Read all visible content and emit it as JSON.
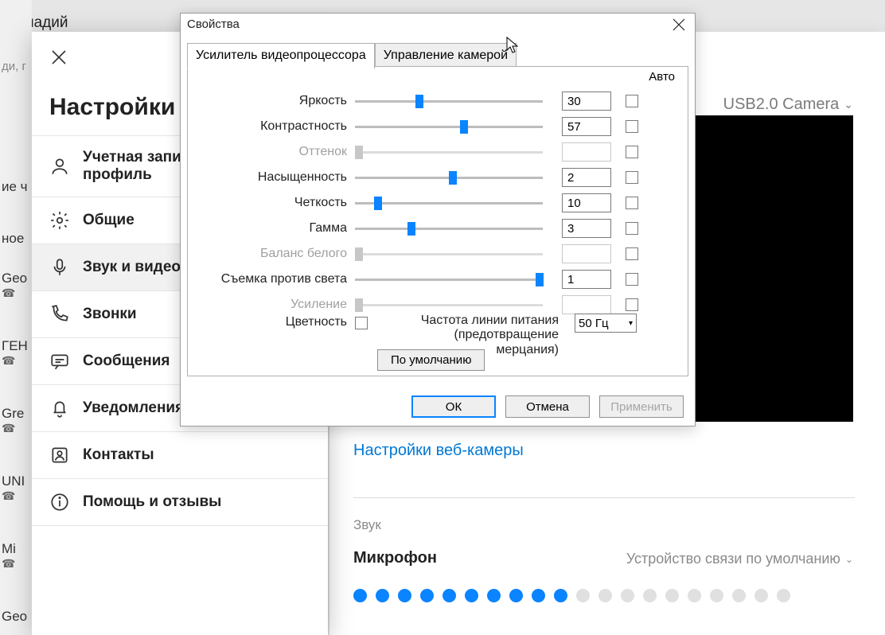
{
  "background": {
    "name": "Геннадий",
    "search_placeholder": "ди, г",
    "contacts": [
      "ие ч",
      "ное",
      "Geo",
      "ГЕН",
      "Gre",
      "UNI",
      "Mi",
      "Geo"
    ]
  },
  "settings": {
    "title": "Настройки",
    "nav": [
      {
        "label": "Учетная запись и профиль"
      },
      {
        "label": "Общие"
      },
      {
        "label": "Звук и видео"
      },
      {
        "label": "Звонки"
      },
      {
        "label": "Сообщения"
      },
      {
        "label": "Уведомления"
      },
      {
        "label": "Контакты"
      },
      {
        "label": "Помощь и отзывы"
      }
    ]
  },
  "right": {
    "camera_device": "USB2.0 Camera",
    "webcam_settings_link": "Настройки веб-камеры",
    "sound_section": "Звук",
    "mic_label": "Микрофон",
    "mic_device": "Устройство связи по умолчанию",
    "mic_level_active": 10,
    "mic_level_total": 20
  },
  "dialog": {
    "title": "Свойства",
    "tabs": [
      "Усилитель видеопроцессора",
      "Управление камерой"
    ],
    "auto_header": "Авто",
    "rows": [
      {
        "label": "Яркость",
        "value": "30",
        "thumb_pct": 32,
        "disabled": false
      },
      {
        "label": "Контрастность",
        "value": "57",
        "thumb_pct": 56,
        "disabled": false
      },
      {
        "label": "Оттенок",
        "value": "",
        "thumb_pct": 0,
        "disabled": true
      },
      {
        "label": "Насыщенность",
        "value": "2",
        "thumb_pct": 50,
        "disabled": false
      },
      {
        "label": "Четкость",
        "value": "10",
        "thumb_pct": 10,
        "disabled": false
      },
      {
        "label": "Гамма",
        "value": "3",
        "thumb_pct": 28,
        "disabled": false
      },
      {
        "label": "Баланс белого",
        "value": "",
        "thumb_pct": 0,
        "disabled": true
      },
      {
        "label": "Съемка против света",
        "value": "1",
        "thumb_pct": 96,
        "disabled": false
      },
      {
        "label": "Усиление",
        "value": "",
        "thumb_pct": 0,
        "disabled": true
      }
    ],
    "color_label": "Цветность",
    "freq_multiline": "Частота линии питания (предотвращение мерцания)",
    "freq_value": "50 Гц",
    "default_btn": "По умолчанию",
    "ok": "ОК",
    "cancel": "Отмена",
    "apply": "Применить"
  }
}
